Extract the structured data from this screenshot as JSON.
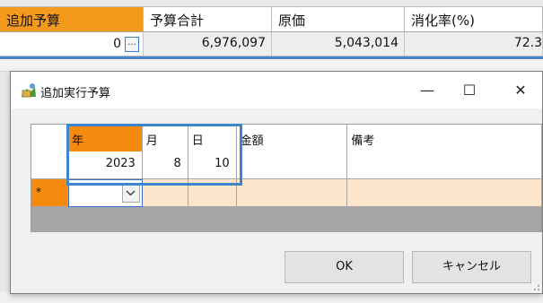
{
  "background_sheet": {
    "headers": [
      "追加予算",
      "予算合計",
      "原価",
      "消化率(%)"
    ],
    "row": {
      "additional_budget": "0",
      "dots_label": "...",
      "budget_total": "6,976,097",
      "cost": "5,043,014",
      "consumption_rate": "72.3"
    }
  },
  "dialog": {
    "title": "追加実行予算",
    "window_buttons": {
      "minimize": "—",
      "maximize": "☐",
      "close": "✕"
    },
    "columns": [
      "",
      "年",
      "月",
      "日",
      "金額",
      "備考"
    ],
    "rows": [
      {
        "header": "",
        "year": "2023",
        "month": "8",
        "day": "10",
        "amount": "",
        "memo": ""
      }
    ],
    "new_row_marker": "*",
    "ok_label": "OK",
    "cancel_label": "キャンセル"
  },
  "colors": {
    "accent_orange": "#f58a0e",
    "selection_blue": "#3b86ce",
    "new_row": "#fde6cb"
  }
}
